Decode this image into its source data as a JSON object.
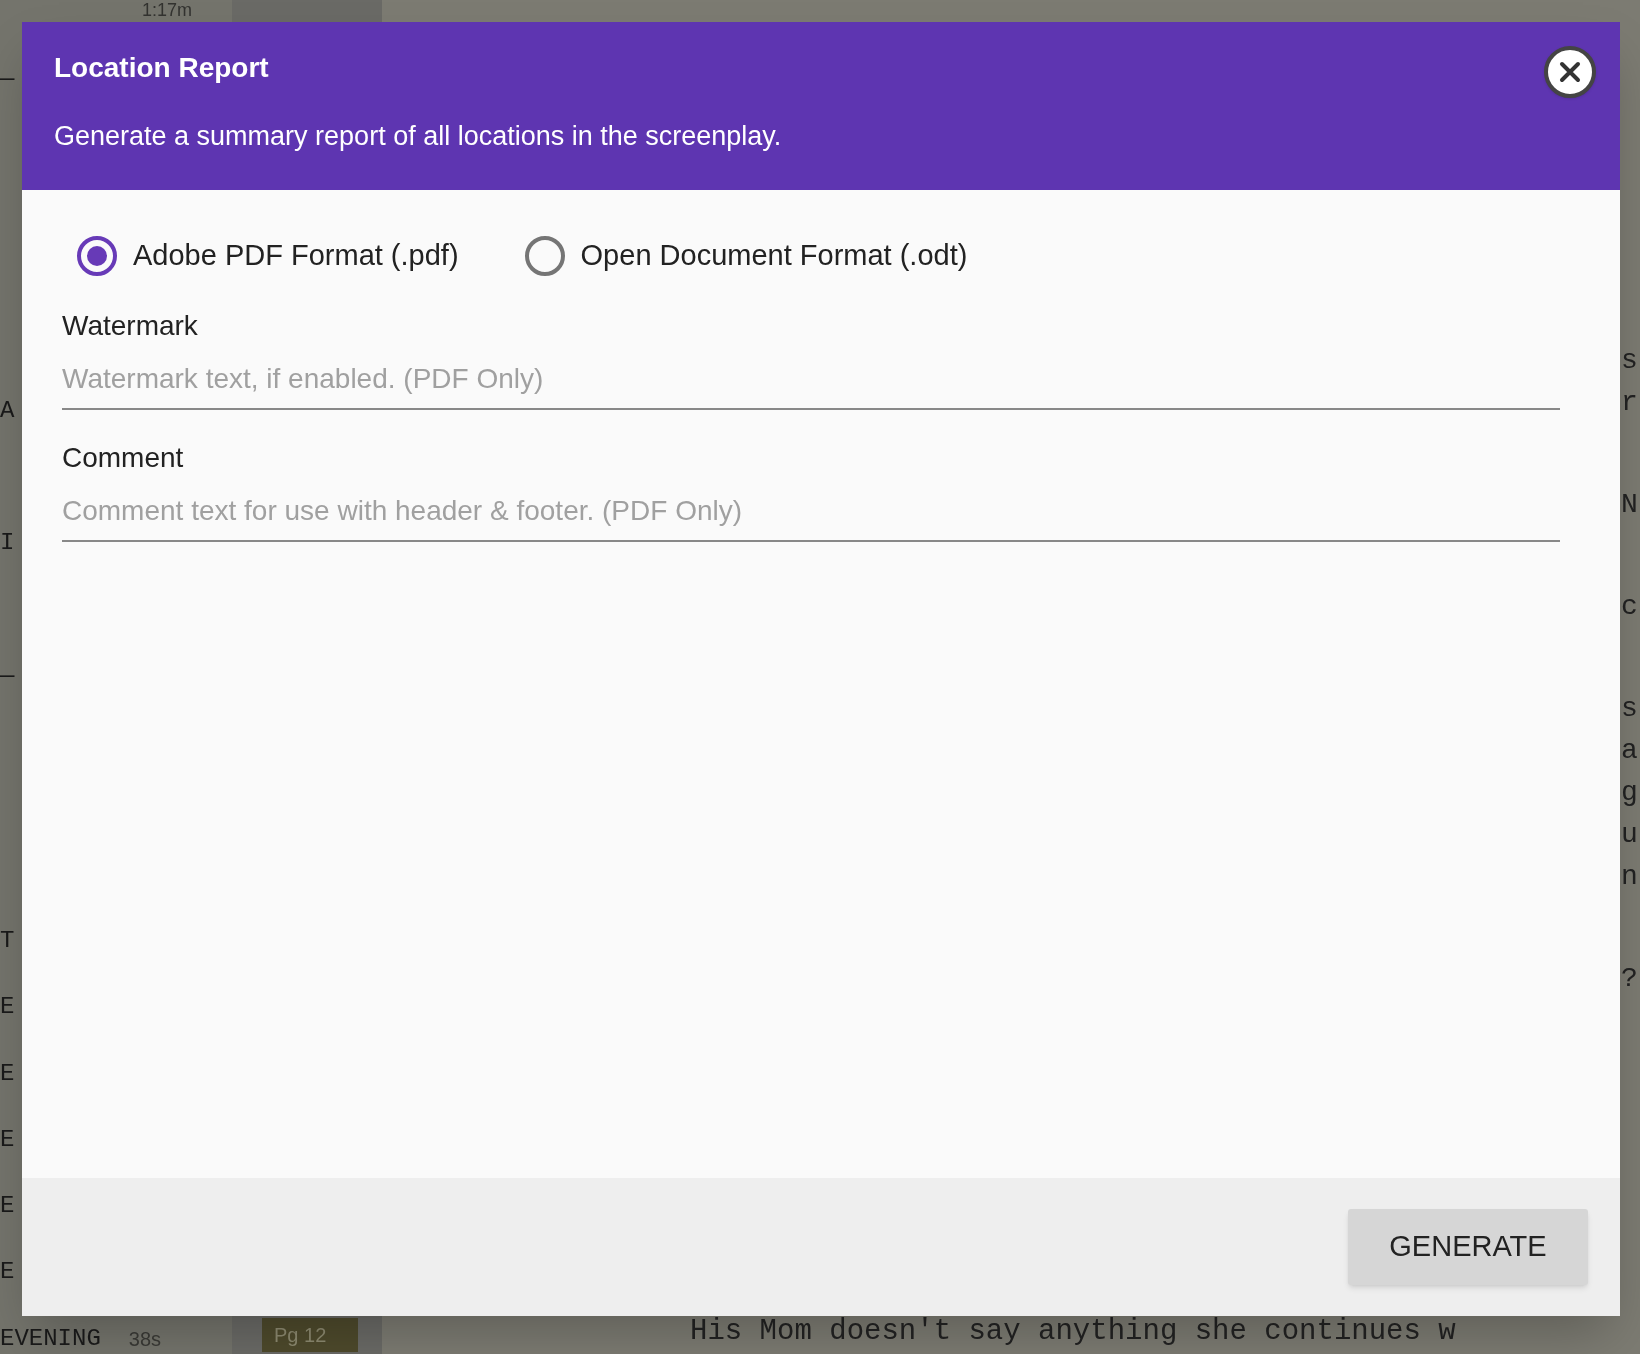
{
  "background": {
    "timer": "1:17m",
    "scene_rows": [
      {
        "kind": "scene",
        "heading": "—"
      },
      {
        "kind": "blank"
      },
      {
        "kind": "blank"
      },
      {
        "kind": "blank"
      },
      {
        "kind": "blank"
      },
      {
        "kind": "scene",
        "heading": "A"
      },
      {
        "kind": "blank"
      },
      {
        "kind": "scene",
        "heading": "I"
      },
      {
        "kind": "blank"
      },
      {
        "kind": "scene",
        "heading": "—"
      },
      {
        "kind": "blank"
      },
      {
        "kind": "blank"
      },
      {
        "kind": "blank"
      },
      {
        "kind": "scene",
        "heading": "T"
      },
      {
        "kind": "scene",
        "heading": "E"
      },
      {
        "kind": "scene",
        "heading": "E"
      },
      {
        "kind": "scene",
        "heading": "E"
      },
      {
        "kind": "scene",
        "heading": "E"
      },
      {
        "kind": "scene",
        "heading": "E"
      },
      {
        "kind": "scene",
        "heading": "EVENING"
      }
    ],
    "last_scene": {
      "duration": "38s",
      "page": "Pg 12"
    },
    "script_fragments": [
      [
        "s",
        "r"
      ],
      [
        "N"
      ],
      [
        "c"
      ],
      [
        "s",
        "a",
        "g",
        "u",
        "n"
      ],
      [
        "?"
      ]
    ],
    "script_line": "His Mom doesn't say anything she continues w"
  },
  "dialog": {
    "title": "Location Report",
    "subtitle": "Generate a summary report of all locations in the screenplay.",
    "formats": [
      {
        "label": "Adobe PDF Format (.pdf)",
        "selected": true
      },
      {
        "label": "Open Document Format (.odt)",
        "selected": false
      }
    ],
    "fields": [
      {
        "label": "Watermark",
        "placeholder": "Watermark text, if enabled. (PDF Only)"
      },
      {
        "label": "Comment",
        "placeholder": "Comment text for use with header & footer. (PDF Only)"
      }
    ],
    "button": "GENERATE"
  }
}
